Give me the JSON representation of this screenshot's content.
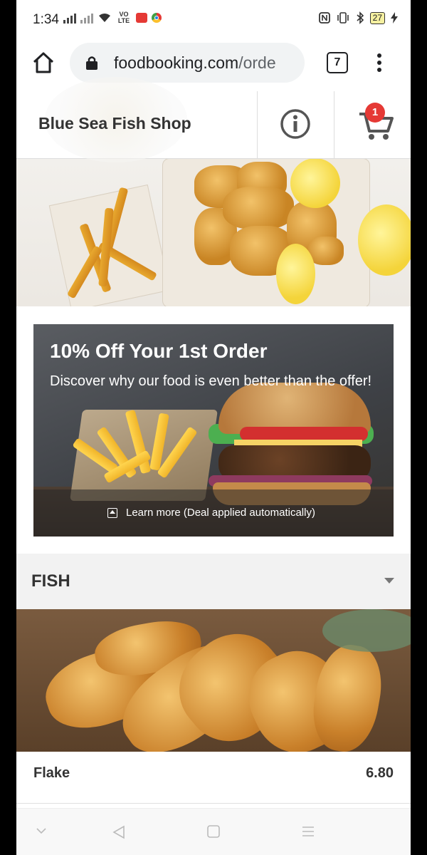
{
  "status_bar": {
    "time": "1:34",
    "volte": "VO LTE",
    "battery": "27",
    "icons": [
      "signal-icon",
      "signal-x-icon",
      "wifi-icon",
      "volte-icon",
      "screen-record-icon",
      "chrome-icon",
      "nfc-icon",
      "vibrate-icon",
      "bluetooth-icon",
      "battery-icon",
      "charging-icon"
    ]
  },
  "browser": {
    "url_host": "foodbooking.com",
    "url_path": "/orde",
    "tab_count": "7"
  },
  "header": {
    "shop_name": "Blue Sea Fish Shop",
    "cart_count": "1"
  },
  "promo": {
    "title": "10% Off Your 1st Order",
    "subtitle": "Discover why our food is even better than the offer!",
    "learn_more": "Learn more (Deal applied automatically)"
  },
  "category": {
    "title": "FISH"
  },
  "items": [
    {
      "name": "Flake",
      "price": "6.80"
    }
  ],
  "colors": {
    "badge": "#e53935",
    "category_bg": "#f2f2f2",
    "text": "#333333"
  }
}
